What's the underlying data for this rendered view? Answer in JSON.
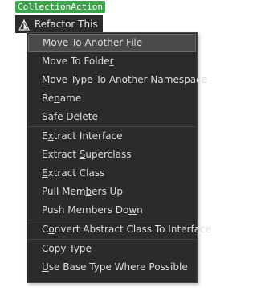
{
  "tag": {
    "label": "CollectionAction"
  },
  "header": {
    "title": "Refactor This",
    "icon": "refactor-icon"
  },
  "menu": {
    "groups": [
      [
        {
          "pre": "Move To Another F",
          "mn": "i",
          "post": "le",
          "selected": true
        },
        {
          "pre": "Move To Folde",
          "mn": "r",
          "post": ""
        },
        {
          "pre": "",
          "mn": "M",
          "post": "ove Type To Another Namespace"
        },
        {
          "pre": "Re",
          "mn": "n",
          "post": "ame"
        },
        {
          "pre": "Sa",
          "mn": "f",
          "post": "e Delete"
        }
      ],
      [
        {
          "pre": "E",
          "mn": "x",
          "post": "tract Interface"
        },
        {
          "pre": "Extract ",
          "mn": "S",
          "post": "uperclass"
        },
        {
          "pre": "",
          "mn": "E",
          "post": "xtract Class"
        },
        {
          "pre": "Pull Mem",
          "mn": "b",
          "post": "ers Up"
        },
        {
          "pre": "Push Members Do",
          "mn": "w",
          "post": "n"
        }
      ],
      [
        {
          "pre": "C",
          "mn": "o",
          "post": "nvert Abstract Class To Interface"
        }
      ],
      [
        {
          "pre": "",
          "mn": "C",
          "post": "opy Type"
        },
        {
          "pre": "",
          "mn": "U",
          "post": "se Base Type Where Possible"
        }
      ]
    ]
  },
  "colors": {
    "tag_bg": "#3fa34d",
    "menu_bg": "#2b2b2b",
    "selected_bg": "#4a4a4a",
    "text": "#dcdcdc"
  }
}
